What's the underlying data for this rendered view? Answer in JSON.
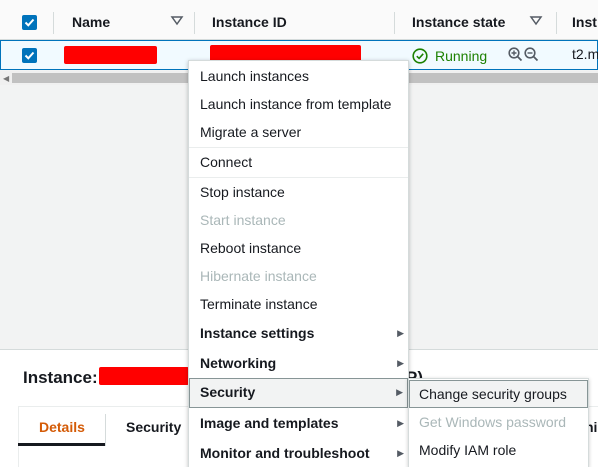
{
  "colors": {
    "accent": "#0073bb",
    "running": "#1d8102",
    "active_tab": "#d45b07",
    "redaction": "#ff0000"
  },
  "table": {
    "columns": [
      {
        "label": "Name",
        "sortable": true
      },
      {
        "label": "Instance ID",
        "sortable": false
      },
      {
        "label": "Instance state",
        "sortable": true
      },
      {
        "label": "Inst",
        "sortable": false
      }
    ],
    "row": {
      "selected": true,
      "state_label": "Running",
      "state_icon": "check-circle-icon",
      "instance_type": "t2.m"
    }
  },
  "context_menu": {
    "items": [
      {
        "label": "Launch instances"
      },
      {
        "label": "Launch instance from template"
      },
      {
        "label": "Migrate a server"
      },
      {
        "label": "Connect"
      },
      {
        "label": "Stop instance"
      },
      {
        "label": "Start instance",
        "disabled": true
      },
      {
        "label": "Reboot instance"
      },
      {
        "label": "Hibernate instance",
        "disabled": true
      },
      {
        "label": "Terminate instance"
      },
      {
        "label": "Instance settings",
        "submenu": true
      },
      {
        "label": "Networking",
        "submenu": true
      },
      {
        "label": "Security",
        "submenu": true,
        "hover": true
      },
      {
        "label": "Image and templates",
        "submenu": true
      },
      {
        "label": "Monitor and troubleshoot",
        "submenu": true
      }
    ],
    "submenu_arrow": "▶"
  },
  "security_submenu": {
    "items": [
      {
        "label": "Change security groups",
        "hover": true
      },
      {
        "label": "Get Windows password",
        "disabled": true
      },
      {
        "label": "Modify IAM role"
      }
    ]
  },
  "details_panel": {
    "title_prefix": "Instance:",
    "title_suffix": "P)",
    "tabs": [
      {
        "label": "Details",
        "active": true
      },
      {
        "label": "Security"
      },
      {
        "label": "ni"
      }
    ]
  }
}
